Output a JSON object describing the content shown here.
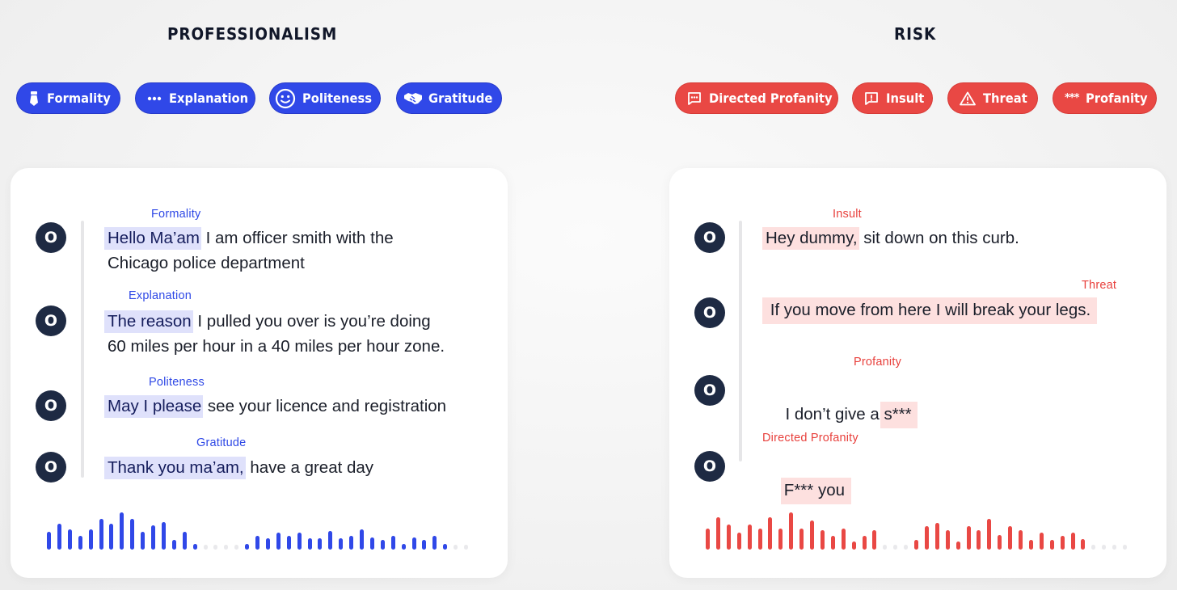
{
  "professionalism": {
    "title": "PROFESSIONALISM",
    "accent": "#3048e8",
    "chips": [
      {
        "label": "Formality",
        "icon": "tie-icon"
      },
      {
        "label": "Explanation",
        "icon": "ellipsis-icon"
      },
      {
        "label": "Politeness",
        "icon": "smiley-icon"
      },
      {
        "label": "Gratitude",
        "icon": "handshake-icon"
      }
    ],
    "avatar_letter": "O",
    "transcript": [
      {
        "tag": "Formality",
        "highlight": "Hello Ma’am",
        "rest": " I am officer smith with the",
        "line2": "Chicago police department"
      },
      {
        "tag": "Explanation",
        "highlight": "The reason",
        "rest": " I pulled you over is you’re doing",
        "line2": "60 miles per hour in a 40 miles per hour zone."
      },
      {
        "tag": "Politeness",
        "highlight": "May I please",
        "rest": " see your licence and registration",
        "line2": ""
      },
      {
        "tag": "Gratitude",
        "highlight": "Thank you ma’am,",
        "rest": " have a great day",
        "line2": ""
      }
    ],
    "waveform": [
      0.48,
      0.7,
      0.55,
      0.36,
      0.55,
      0.83,
      0.7,
      1.0,
      0.83,
      0.48,
      0.66,
      0.74,
      0.27,
      0.48,
      0.15,
      0,
      0,
      0,
      0,
      0.15,
      0.36,
      0.3,
      0.45,
      0.36,
      0.45,
      0.3,
      0.3,
      0.51,
      0.3,
      0.36,
      0.54,
      0.33,
      0.27,
      0.36,
      0.15,
      0.33,
      0.27,
      0.36,
      0.15,
      0,
      0
    ]
  },
  "risk": {
    "title": "RISK",
    "accent": "#e94844",
    "chips": [
      {
        "label": "Directed Profanity",
        "icon": "message-dots-icon"
      },
      {
        "label": "Insult",
        "icon": "message-alert-icon"
      },
      {
        "label": "Threat",
        "icon": "warning-triangle-icon"
      },
      {
        "label": "Profanity",
        "icon": "asterisks-icon"
      }
    ],
    "avatar_letter": "O",
    "transcript": [
      {
        "tag": "Insult",
        "pre": "",
        "highlight": "Hey dummy,",
        "rest": " sit down on this curb."
      },
      {
        "tag": "Threat",
        "pre": "",
        "highlight": " If you move from here I will break your legs. ",
        "rest": ""
      },
      {
        "tag": "Profanity",
        "pre": " I don’t give a ",
        "highlight": "s*** ",
        "rest": ""
      },
      {
        "tag": "Directed Profanity",
        "pre": "",
        "highlight": "F*** you ",
        "rest": ""
      }
    ],
    "waveform": [
      0.57,
      0.86,
      0.67,
      0.45,
      0.67,
      0.57,
      0.86,
      0.57,
      1.0,
      0.57,
      0.79,
      0.52,
      0.36,
      0.57,
      0.21,
      0.36,
      0.52,
      0,
      0,
      0,
      0.27,
      0.62,
      0.71,
      0.52,
      0.21,
      0.64,
      0.52,
      0.83,
      0.4,
      0.62,
      0.52,
      0.27,
      0.45,
      0.27,
      0.36,
      0.45,
      0.29,
      0,
      0,
      0,
      0
    ]
  }
}
